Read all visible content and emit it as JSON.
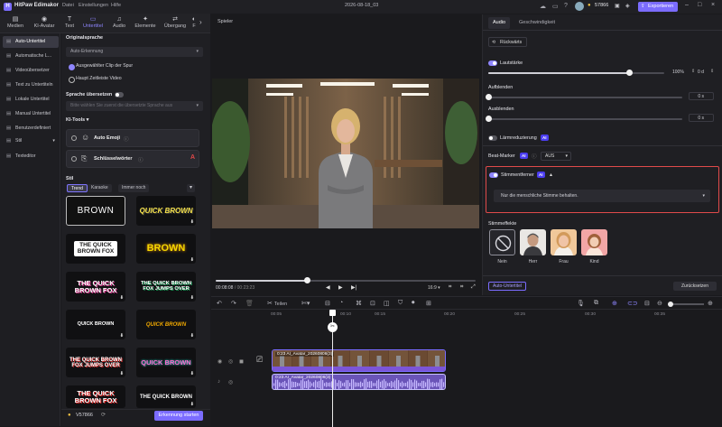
{
  "app": {
    "title": "HitPaw Edimakor",
    "menu": [
      "Datei",
      "Einstellungen",
      "Hilfe"
    ],
    "project_name": "2026-08-18_03",
    "credits": "57866",
    "export_label": "Exportieren",
    "accent": "#7b6cff"
  },
  "toptabs": [
    {
      "label": "Medien",
      "icon": "media-icon"
    },
    {
      "label": "KI-Avatar",
      "icon": "ai-avatar-icon"
    },
    {
      "label": "Text",
      "icon": "text-icon"
    },
    {
      "label": "Untertitel",
      "icon": "subtitle-icon",
      "active": true
    },
    {
      "label": "Audio",
      "icon": "audio-icon"
    },
    {
      "label": "Elemente",
      "icon": "elements-icon"
    },
    {
      "label": "Übergang",
      "icon": "transition-icon"
    },
    {
      "label": "F",
      "icon": "filter-icon"
    }
  ],
  "leftnav": [
    {
      "label": "Auto-Untertitel",
      "active": true
    },
    {
      "label": "Automatische L..."
    },
    {
      "label": "Videoübersetzer"
    },
    {
      "label": "Text zu Untertiteln"
    },
    {
      "label": "Lokale Untertitel"
    },
    {
      "label": "Manual Untertitel"
    },
    {
      "label": "Benutzerdefiniert"
    },
    {
      "label": "Stil"
    },
    {
      "label": "Texteditor"
    }
  ],
  "subtitle_panel": {
    "original_heading": "Originalsprache",
    "language_value": "Auto-Erkennung",
    "radio_selected_clip": "Ausgewählter Clip der Spur",
    "radio_main_video": "Haupt Zeitleiste Video",
    "translate_heading": "Sprache übersetzen",
    "translate_placeholder": "Bitte wählen Sie zuerst die übersetzte Sprache aus",
    "ai_tools_heading": "KI-Tools",
    "tool_auto_emoji": "Auto Emoji",
    "tool_keywords": "Schlüsselwörter",
    "style_heading": "Stil",
    "style_chips": [
      "Trend",
      "Karaoke",
      "Immer noch"
    ],
    "presets": [
      "BROWN",
      "QUICK BROWN",
      "THE QUICK BROWN FOX",
      "BROWN",
      "THE QUICK BROWN FOX",
      "THE QUICK BROWN FOX JUMPS OVER",
      "QUICK BROWN",
      "QUICK BROWN",
      "THE QUICK BROWN FOX JUMPS OVER",
      "QUICK BROWN",
      "THE QUICK BROWN FOX",
      "THE QUICK BROWN"
    ],
    "credits_cost": "V57866",
    "start_button": "Erkennung starten"
  },
  "player": {
    "label": "Spieler",
    "current_time": "00:08:08",
    "total_time": "00:23:23",
    "progress": 0.35,
    "aspect": "16:9"
  },
  "audio_panel": {
    "tabs": [
      "Audio",
      "Geschwindigkeit"
    ],
    "back_button": "Rückwärts",
    "volume_label": "Lautstärke",
    "volume_value": "100%",
    "volume_level": 0.8,
    "fade_in_label": "Aufblenden",
    "fade_in_value": "0",
    "fade_out_label": "Ausblenden",
    "fade_out_value": "0",
    "unit_seconds": "s",
    "unit_db": "d",
    "noise_label": "Lärmreduzierung",
    "beat_label": "Beat-Marker",
    "beat_value": "AUS",
    "voice_remover_label": "Stimmentferner",
    "voice_remover_value": "Nur die menschliche Stimme behalten.",
    "voice_effects_label": "Stimmeffekte",
    "voices": [
      "Nein",
      "Herr",
      "Frau",
      "Kind"
    ],
    "auto_subtitle_button": "Auto-Untertitel",
    "reset_button": "Zurücksetzen",
    "ai_badge": "AI"
  },
  "timeline": {
    "split_label": "Teilen",
    "ruler_ticks": [
      "00:05",
      "00:10",
      "00:15",
      "00:20",
      "00:25",
      "00:30",
      "00:35"
    ],
    "video_clip_label": "0:23  AI_Avatar_20260806(3)",
    "audio_clip_label": "0:23  AI_Avatar_20260806(3)"
  }
}
